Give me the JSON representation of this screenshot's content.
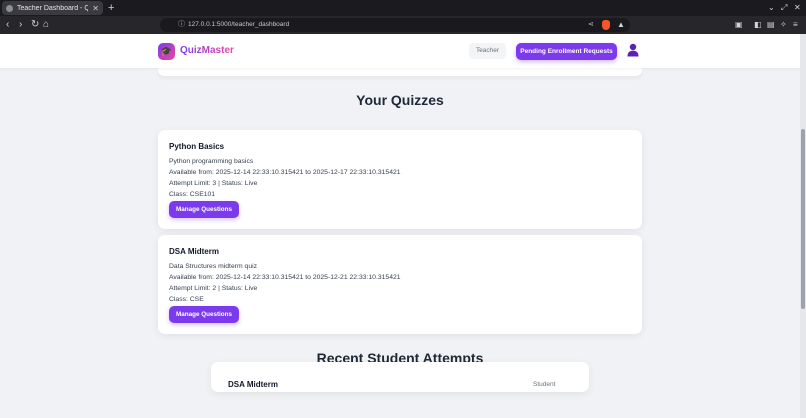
{
  "browser": {
    "tab_title": "Teacher Dashboard - Qui",
    "new_tab": "+",
    "url": "127.0.0.1:5000/teacher_dashboard",
    "window_controls": [
      "⌄",
      "⤢",
      "✕"
    ]
  },
  "navbar": {
    "logo_text": "QuizMaster",
    "role_badge": "Teacher",
    "pending_button": "Pending Enrollment Requests",
    "user_icon": "user-icon"
  },
  "quizzes_section": {
    "title": "Your Quizzes",
    "quizzes": [
      {
        "title": "Python Basics",
        "description": "Python programming basics",
        "availability": "Available from: 2025-12-14 22:33:10.315421 to 2025-12-17 22:33:10.315421",
        "limit_status": "Attempt Limit: 3 | Status: Live",
        "class": "Class: CSE101",
        "button": "Manage Questions"
      },
      {
        "title": "DSA Midterm",
        "description": "Data Structures midterm quiz",
        "availability": "Available from: 2025-12-14 22:33:10.315421 to 2025-12-21 22:33:10.315421",
        "limit_status": "Attempt Limit: 2 | Status: Live",
        "class": "Class: CSE",
        "button": "Manage Questions"
      }
    ]
  },
  "attempts_section": {
    "title": "Recent Student Attempts",
    "first_attempt": {
      "quiz": "DSA Midterm",
      "meta": "Student"
    }
  },
  "colors": {
    "accent": "#7c3aed",
    "accent_pink": "#ec4899",
    "page_bg": "#f0f2f5"
  }
}
